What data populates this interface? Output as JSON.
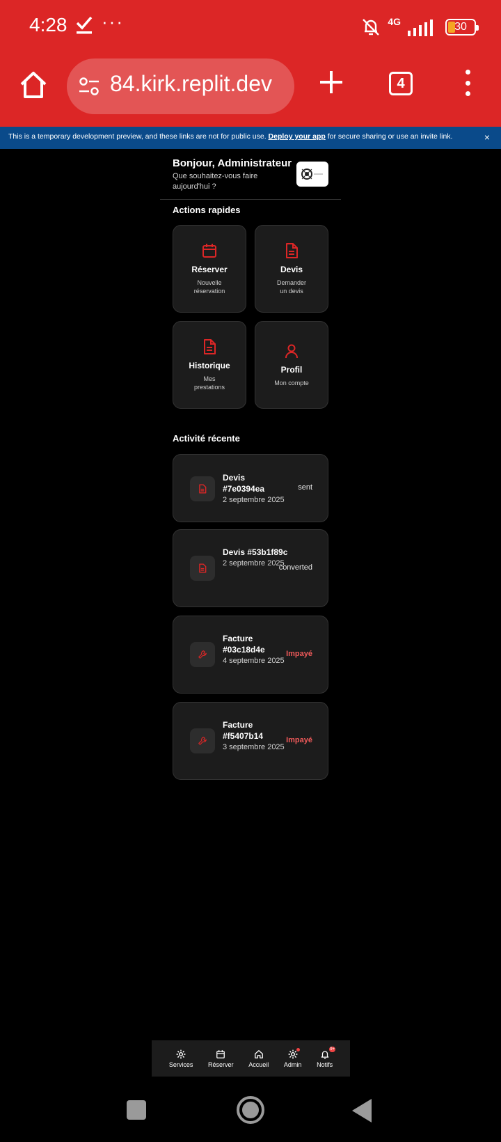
{
  "status_bar": {
    "time": "4:28",
    "network": "4G",
    "battery": "30",
    "icons": [
      "check-icon",
      "more-dots-icon",
      "mute-bell-icon",
      "signal-icon",
      "battery-icon"
    ]
  },
  "browser": {
    "url": "84.kirk.replit.dev",
    "tab_count": "4",
    "icons": [
      "home-icon",
      "tune-icon",
      "plus-icon",
      "tabs-icon",
      "menu-icon"
    ]
  },
  "banner": {
    "text_before": "This is a temporary development preview, and these links are not for public use.",
    "link": "Deploy your app",
    "text_after": "for secure sharing or use an invite link.",
    "close": "×"
  },
  "header": {
    "greeting": "Bonjour, Administrateur",
    "subtitle": "Que souhaitez-vous faire aujourd'hui ?"
  },
  "quick_actions": {
    "title": "Actions rapides",
    "items": [
      {
        "label": "Réserver",
        "sub": "Nouvelle réservation",
        "icon": "calendar-icon"
      },
      {
        "label": "Devis",
        "sub": "Demander un devis",
        "icon": "document-icon"
      },
      {
        "label": "Historique",
        "sub": "Mes prestations",
        "icon": "document-icon"
      },
      {
        "label": "Profil",
        "sub": "Mon compte",
        "icon": "user-icon"
      }
    ]
  },
  "recent_activity": {
    "title": "Activité récente",
    "items": [
      {
        "title": "Devis #7e0394ea",
        "date": "2 septembre 2025",
        "status": "sent",
        "icon": "document-icon"
      },
      {
        "title": "Devis #53b1f89c",
        "date": "2 septembre 2025",
        "status": "converted",
        "icon": "document-icon"
      },
      {
        "title": "Facture #03c18d4e",
        "date": "4 septembre 2025",
        "status": "Impayé",
        "icon": "wrench-icon"
      },
      {
        "title": "Facture #f5407b14",
        "date": "3 septembre 2025",
        "status": "Impayé",
        "icon": "wrench-icon"
      }
    ]
  },
  "bottom_nav": {
    "items": [
      {
        "label": "Services",
        "icon": "gear-icon"
      },
      {
        "label": "Réserver",
        "icon": "calendar-icon"
      },
      {
        "label": "Accueil",
        "icon": "home-icon"
      },
      {
        "label": "Admin",
        "icon": "gear-icon"
      },
      {
        "label": "Notifs",
        "icon": "bell-icon"
      }
    ],
    "notif_badge": "9+"
  },
  "colors": {
    "accent": "#dc2626",
    "banner": "#0a4a8a",
    "card": "#1c1c1c",
    "unpaid": "#f05a5a"
  }
}
